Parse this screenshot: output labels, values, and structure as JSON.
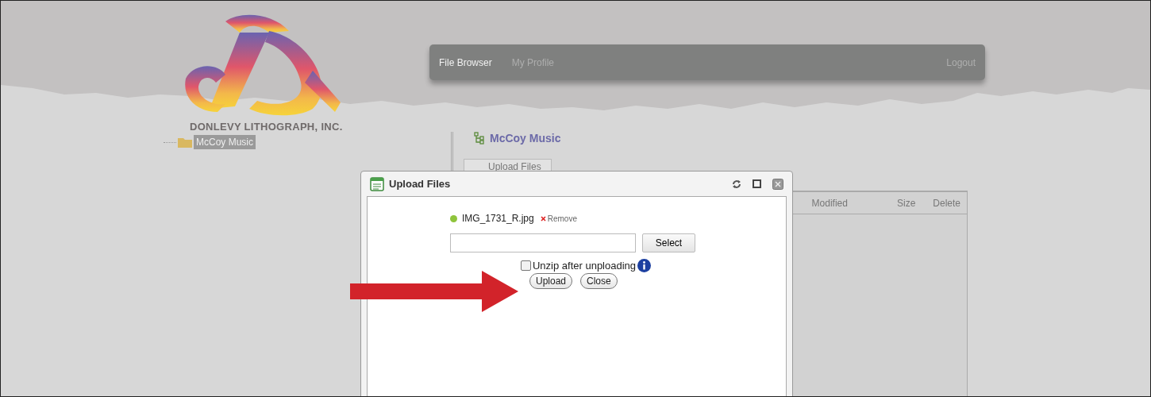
{
  "logo": {
    "company": "DONLEVY LITHOGRAPH, INC."
  },
  "sidebar": {
    "tree": [
      {
        "label": "McCoy Music",
        "selected": true
      }
    ]
  },
  "nav": {
    "items": [
      {
        "label": "File Browser",
        "selected": true
      },
      {
        "label": "My Profile",
        "selected": false
      }
    ],
    "logout": "Logout"
  },
  "panel": {
    "title": "McCoy Music",
    "upload_button": "Upload Files",
    "table": {
      "columns": [
        "Modified",
        "Size",
        "Delete"
      ]
    }
  },
  "dialog": {
    "title": "Upload Files",
    "files": [
      {
        "name": "IMG_1731_R.jpg",
        "remove": "Remove"
      }
    ],
    "select_button": "Select",
    "unzip": {
      "label": "Unzip after unploading",
      "checked": false
    },
    "buttons": [
      "Upload",
      "Close"
    ]
  }
}
